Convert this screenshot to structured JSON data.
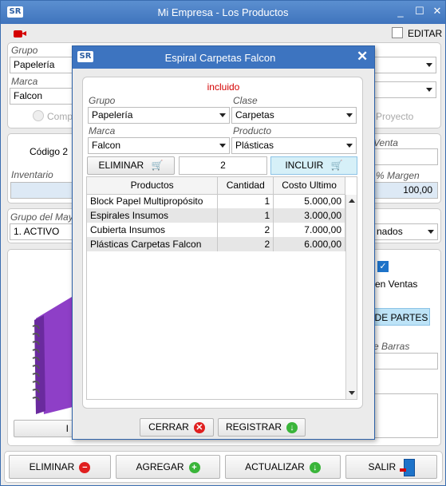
{
  "main": {
    "title": "Mi Empresa - Los Productos",
    "logo": "SR",
    "editar_label": "EDITAR",
    "grupo_label": "Grupo",
    "grupo_value": "Papelería",
    "marca_label": "Marca",
    "marca_value": "Falcon",
    "comp_label": "Comp",
    "proyecto_label": "Proyecto",
    "codigo_label": "Código 2",
    "venta_label": "Venta",
    "inventario_label": "Inventario",
    "margen_label": "% Margen",
    "margen_value": "100,00",
    "grupo_mayor_label": "Grupo del May",
    "grupo_mayor_value": "1. ACTIVO",
    "nados_value": "nados",
    "en_ventas_label": "en Ventas",
    "de_partes_label": "DE PARTES",
    "barras_label": "e Barras",
    "i_label": "I",
    "buttons": {
      "eliminar": "ELIMINAR",
      "agregar": "AGREGAR",
      "actualizar": "ACTUALIZAR",
      "salir": "SALIR"
    }
  },
  "dialog": {
    "title": "Espiral Carpetas Falcon",
    "logo": "SR",
    "status": "incluido",
    "grupo_label": "Grupo",
    "grupo_value": "Papelería",
    "clase_label": "Clase",
    "clase_value": "Carpetas",
    "marca_label": "Marca",
    "marca_value": "Falcon",
    "producto_label": "Producto",
    "producto_value": "Plásticas",
    "eliminar_label": "ELIMINAR",
    "quantity": "2",
    "incluir_label": "INCLUIR",
    "columns": [
      "Productos",
      "Cantidad",
      "Costo Ultimo"
    ],
    "rows": [
      {
        "producto": "Block Papel Multipropósito",
        "cantidad": "1",
        "costo": "5.000,00"
      },
      {
        "producto": "Espirales Insumos",
        "cantidad": "1",
        "costo": "3.000,00"
      },
      {
        "producto": "Cubierta Insumos",
        "cantidad": "2",
        "costo": "7.000,00"
      },
      {
        "producto": "Plásticas Carpetas Falcon",
        "cantidad": "2",
        "costo": "6.000,00"
      }
    ],
    "cerrar_label": "CERRAR",
    "registrar_label": "REGISTRAR"
  },
  "colors": {
    "title_bar": "#3f74bd",
    "status_red": "#d40000",
    "incluir_bg": "#d6f0f8",
    "de_partes_bg": "#bde3f7"
  },
  "icons": [
    "camera-icon",
    "cart-remove-icon",
    "cart-add-icon",
    "close-circle-icon",
    "arrow-down-circle-icon",
    "minus-circle-icon",
    "plus-circle-icon",
    "exit-door-icon",
    "checkbox-checked-icon"
  ]
}
